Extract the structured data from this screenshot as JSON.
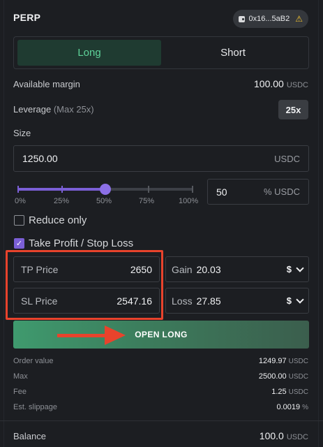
{
  "header": {
    "title": "PERP",
    "wallet_address": "0x16...5aB2",
    "warning_icon": "warning-icon"
  },
  "side": {
    "long_label": "Long",
    "short_label": "Short",
    "selected": "Long"
  },
  "margin": {
    "label": "Available margin",
    "value": "100.00",
    "unit": "USDC"
  },
  "leverage": {
    "label": "Leverage",
    "hint": "(Max 25x)",
    "value": "25x"
  },
  "size": {
    "label": "Size",
    "value": "1250.00",
    "unit": "USDC"
  },
  "slider": {
    "percent": 50,
    "marks": [
      "0%",
      "25%",
      "50%",
      "75%",
      "100%"
    ],
    "input_value": "50",
    "input_unit": "% USDC"
  },
  "options": {
    "reduce_only_label": "Reduce only",
    "reduce_only_checked": false,
    "tpsl_label": "Take Profit / Stop Loss",
    "tpsl_checked": true
  },
  "tpsl": {
    "tp_label": "TP Price",
    "tp_value": "2650",
    "sl_label": "SL Price",
    "sl_value": "2547.16",
    "gain_label": "Gain",
    "gain_value": "20.03",
    "loss_label": "Loss",
    "loss_value": "27.85",
    "currency": "$"
  },
  "action": {
    "open_label": "OPEN LONG"
  },
  "summary": {
    "rows": [
      {
        "label": "Order value",
        "value": "1249.97",
        "unit": "USDC"
      },
      {
        "label": "Max",
        "value": "2500.00",
        "unit": "USDC"
      },
      {
        "label": "Fee",
        "value": "1.25",
        "unit": "USDC"
      },
      {
        "label": "Est. slippage",
        "value": "0.0019",
        "unit": "%"
      }
    ]
  },
  "balance": {
    "label": "Balance",
    "value": "100.0",
    "unit": "USDC"
  },
  "colors": {
    "accent_long": "#5fd39a",
    "accent_purple": "#7b5fd6",
    "annotation_red": "#e8432c",
    "background": "#1c1e22"
  }
}
